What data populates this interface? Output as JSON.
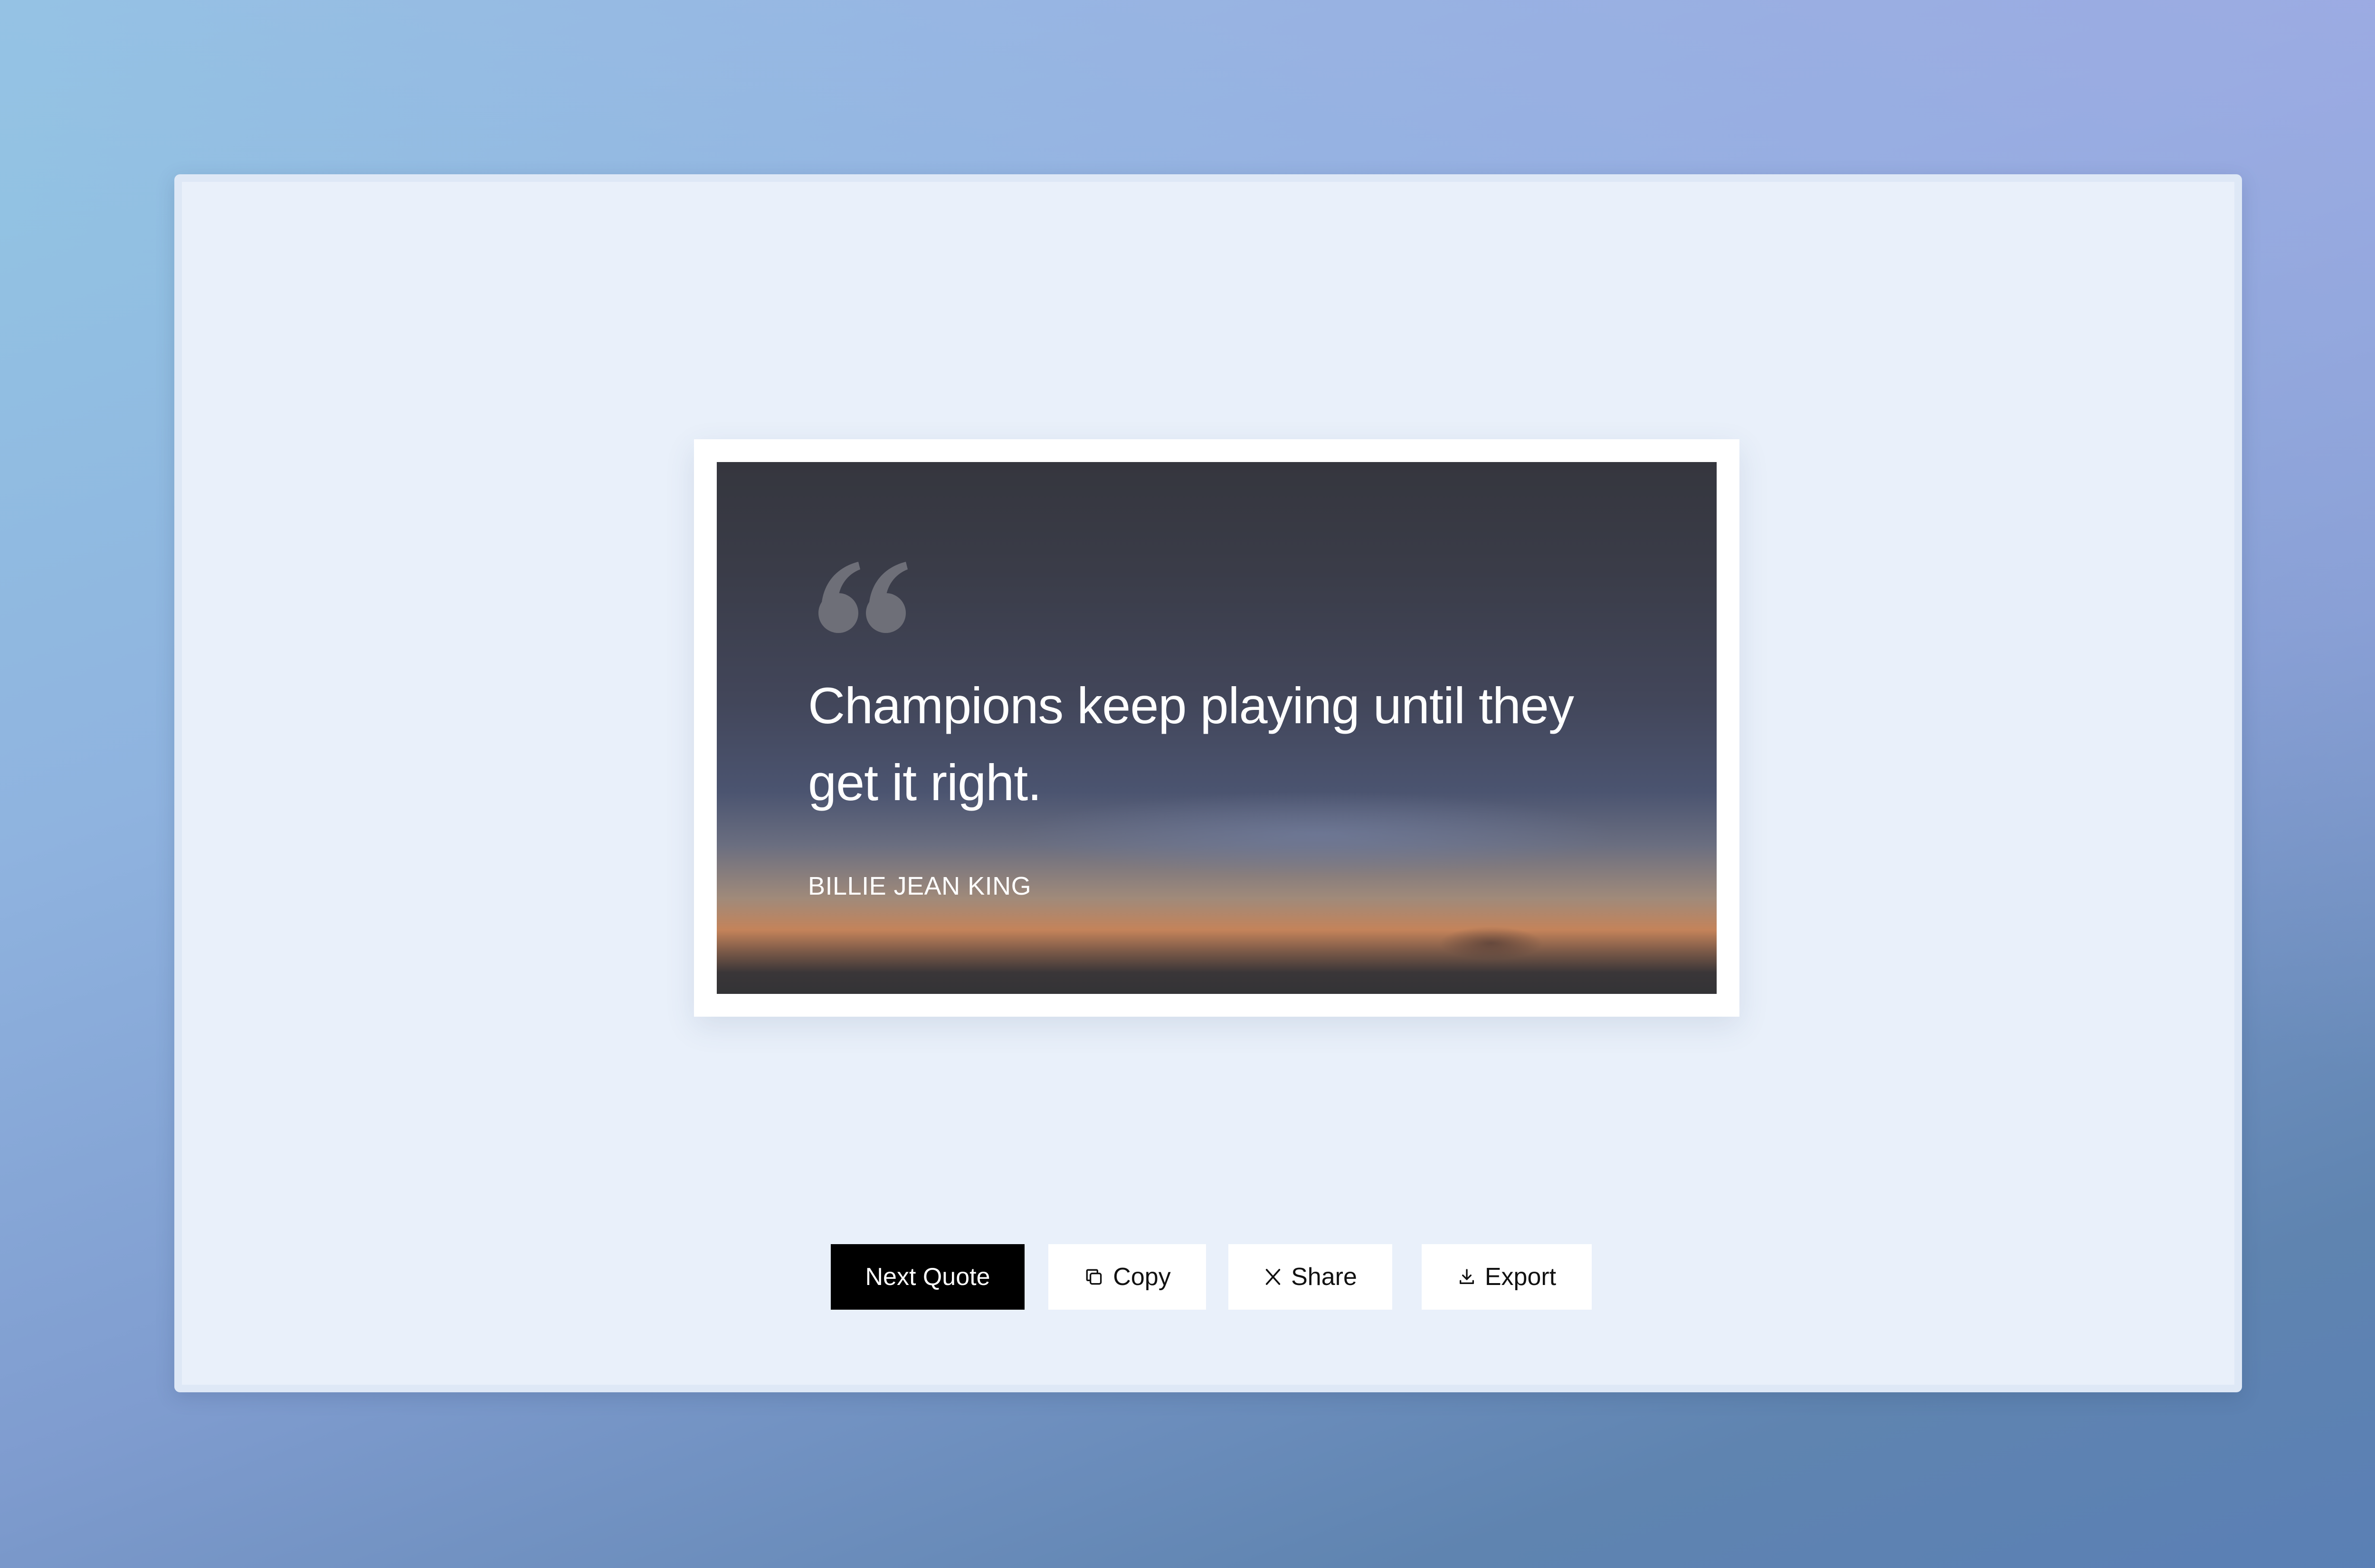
{
  "quote": {
    "mark_icon": "quote-open-icon",
    "text": "Champions keep playing until they get it right.",
    "author": "BILLIE JEAN KING"
  },
  "actions": {
    "next_label": "Next Quote",
    "copy_label": "Copy",
    "copy_icon": "copy-icon",
    "share_label": "Share",
    "share_icon": "x-logo-icon",
    "export_label": "Export",
    "export_icon": "download-icon"
  },
  "colors": {
    "primary_button": "#000000",
    "window_background": "#e9f0fa",
    "quote_text": "#ffffff"
  }
}
